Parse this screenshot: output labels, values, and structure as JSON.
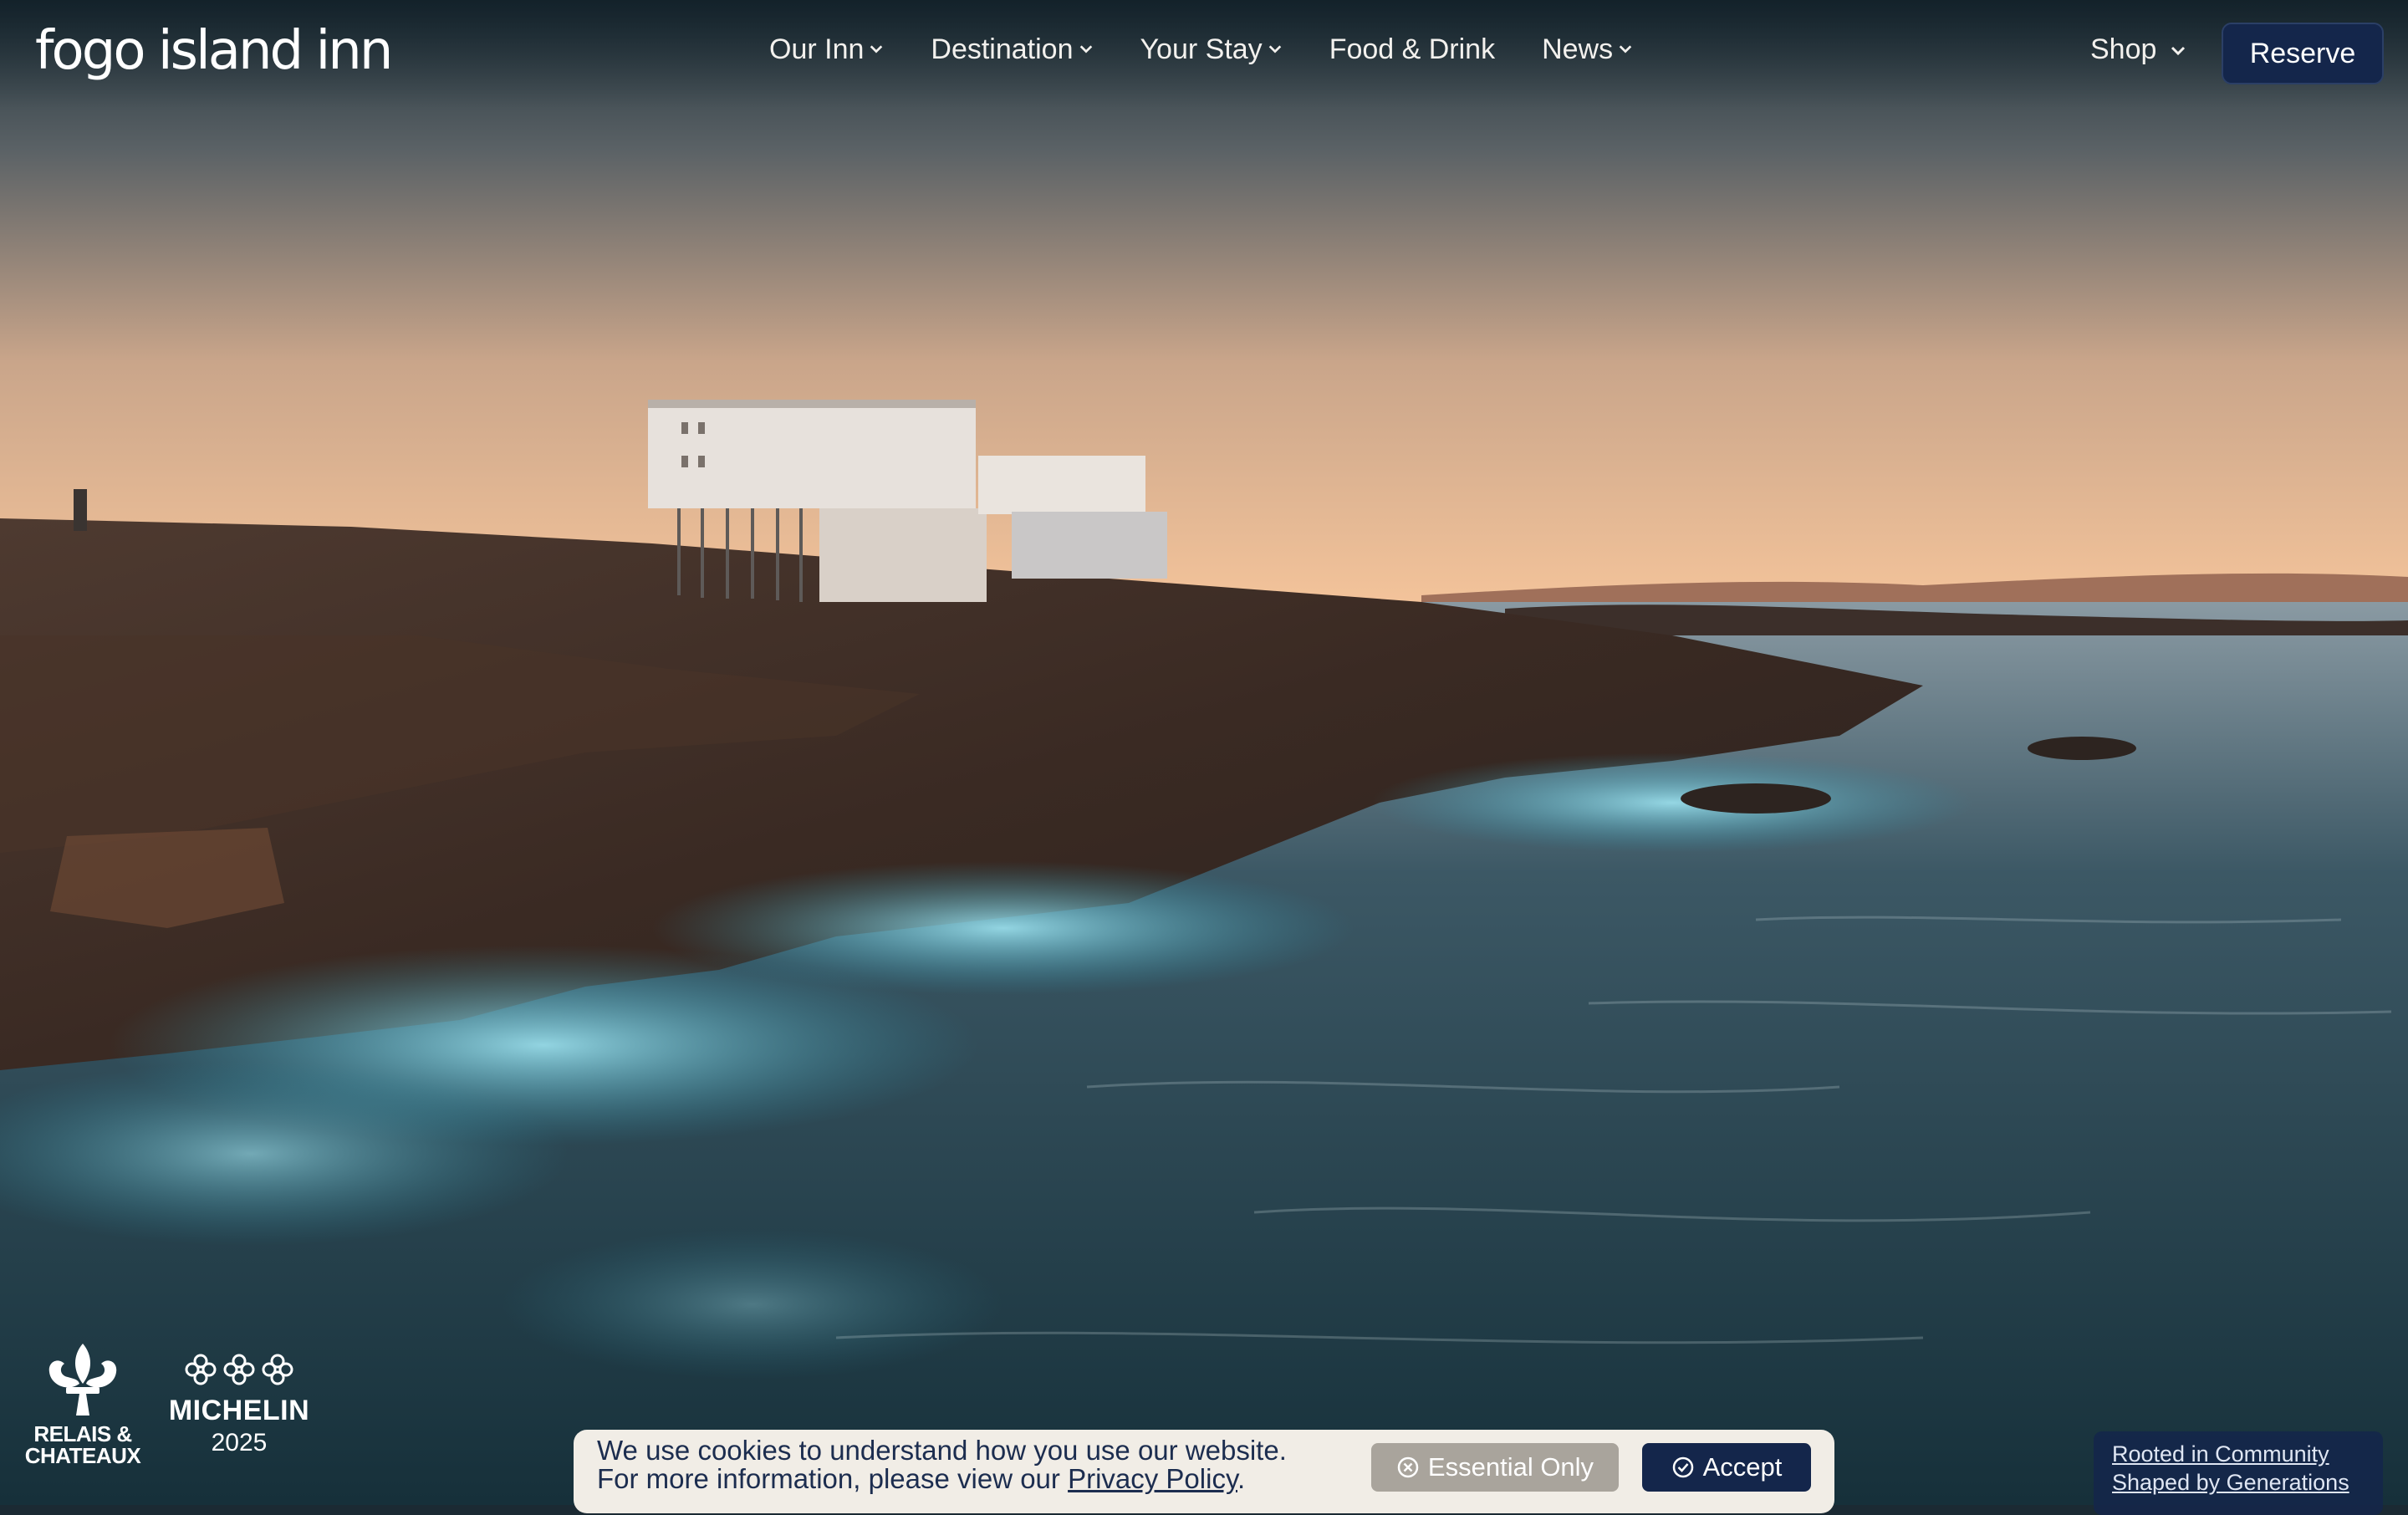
{
  "brand": {
    "logo_text": "fogo island inn"
  },
  "nav": {
    "items": [
      {
        "label": "Our Inn",
        "has_dropdown": true
      },
      {
        "label": "Destination",
        "has_dropdown": true
      },
      {
        "label": "Your Stay",
        "has_dropdown": true
      },
      {
        "label": "Food & Drink",
        "has_dropdown": false
      },
      {
        "label": "News",
        "has_dropdown": true
      }
    ],
    "shop_label": "Shop",
    "reserve_label": "Reserve"
  },
  "awards": {
    "relais_line1": "RELAIS &",
    "relais_line2": "CHATEAUX",
    "michelin_word": "MICHELIN",
    "michelin_year": "2025"
  },
  "cookie": {
    "line1": "We use cookies to understand how you use our website.",
    "line2_prefix": "For more information, please view our ",
    "privacy_link": "Privacy Policy",
    "line2_suffix": ".",
    "essential_label": "Essential Only",
    "accept_label": "Accept"
  },
  "rooted": {
    "line1": "Rooted in Community",
    "line2": "Shaped by Generations"
  },
  "colors": {
    "reserve_bg": "#14264b",
    "cookie_bg": "#f1ede6",
    "essential_bg": "#a9a49c",
    "accept_bg": "#14264b"
  }
}
